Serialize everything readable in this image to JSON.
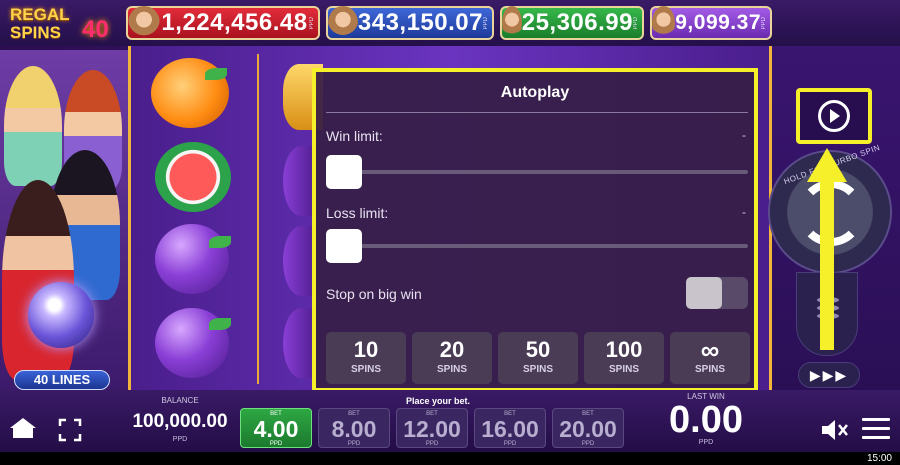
{
  "logo": {
    "line1": "REGAL",
    "line2": "SPINS",
    "number": "40"
  },
  "jackpots": [
    {
      "value": "1,224,456.48",
      "tag": "PPD",
      "color": "#e32c3a"
    },
    {
      "value": "343,150.07",
      "tag": "PPD",
      "color": "#3e67d8"
    },
    {
      "value": "25,306.99",
      "tag": "PPD",
      "color": "#36b84a"
    },
    {
      "value": "9,099.37",
      "tag": "PPD",
      "color": "#a35be6"
    }
  ],
  "lines_badge": "40 LINES",
  "modal": {
    "title": "Autoplay",
    "win_limit_label": "Win limit:",
    "win_limit_value": "-",
    "loss_limit_label": "Loss limit:",
    "loss_limit_value": "-",
    "stop_big_win_label": "Stop on big win",
    "stop_big_win_on": false,
    "spin_options": [
      {
        "count": "10",
        "label": "SPINS"
      },
      {
        "count": "20",
        "label": "SPINS"
      },
      {
        "count": "50",
        "label": "SPINS"
      },
      {
        "count": "100",
        "label": "SPINS"
      },
      {
        "count": "∞",
        "label": "SPINS"
      }
    ]
  },
  "controls": {
    "spin_hint": "HOLD FOR TURBO SPIN",
    "fast_icon": "fast-forward-icon",
    "highlight_color": "#f5f02a"
  },
  "bottom": {
    "balance_label": "BALANCE",
    "balance_value": "100,000.00",
    "balance_unit": "PPD",
    "place_bet": "Place your bet.",
    "bets": [
      {
        "label": "BET",
        "value": "4.00",
        "unit": "PPD",
        "active": true
      },
      {
        "label": "BET",
        "value": "8.00",
        "unit": "PPD",
        "active": false
      },
      {
        "label": "BET",
        "value": "12.00",
        "unit": "PPD",
        "active": false
      },
      {
        "label": "BET",
        "value": "16.00",
        "unit": "PPD",
        "active": false
      },
      {
        "label": "BET",
        "value": "20.00",
        "unit": "PPD",
        "active": false
      }
    ],
    "last_win_label": "LAST WIN",
    "last_win_value": "0.00",
    "last_win_unit": "PPD"
  },
  "status_bar": {
    "time": "15:00"
  }
}
